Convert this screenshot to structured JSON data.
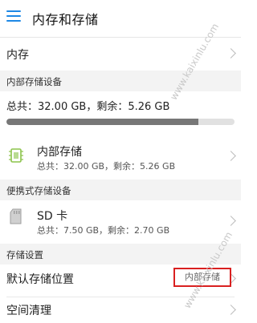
{
  "header": {
    "title": "内存和存储"
  },
  "internal_memory": {
    "label": "内存"
  },
  "sections": {
    "internal_storage": "内部存储设备",
    "portable_storage": "便携式存储设备",
    "storage_settings": "存储设置"
  },
  "storage_summary": {
    "text": "总共：32.00 GB，剩余：5.26 GB",
    "used_fraction": 0.84
  },
  "internal_device": {
    "name": "内部存储",
    "detail": "总共：32.00 GB，剩余：5.26 GB"
  },
  "sd_card": {
    "name": "SD 卡",
    "detail": "总共：7.50 GB，剩余：2.70 GB"
  },
  "settings": {
    "default_location_label": "默认存储位置",
    "default_location_value": "内部存储",
    "cleanup_label": "空间清理"
  },
  "watermarks": [
    "www.kaixinlu.com",
    "www.kaixinlu.com"
  ],
  "colors": {
    "accent": "#1e88e5",
    "highlight_border": "#d92020",
    "chip_icon": "#8bc34a",
    "progress_fill": "#777777"
  }
}
